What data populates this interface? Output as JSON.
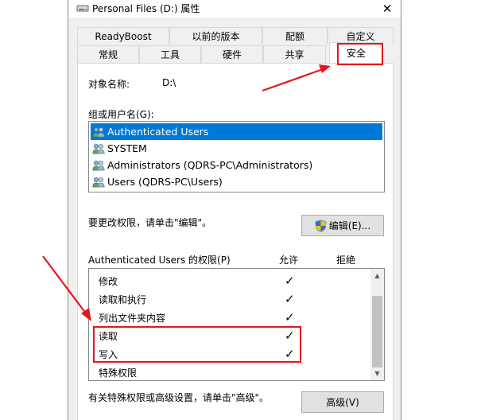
{
  "window": {
    "title": "Personal Files (D:) 属性",
    "close_glyph": "✕"
  },
  "tabs": {
    "row1": [
      "ReadyBoost",
      "以前的版本",
      "配额",
      "自定义"
    ],
    "row2": [
      "常规",
      "工具",
      "硬件",
      "共享",
      "安全"
    ],
    "active": "安全"
  },
  "security": {
    "object_label": "对象名称:",
    "object_value": "D:\\",
    "group_label": "组或用户名(G):",
    "users": [
      "Authenticated Users",
      "SYSTEM",
      "Administrators (QDRS-PC\\Administrators)",
      "Users (QDRS-PC\\Users)"
    ],
    "change_hint": "要更改权限，请单击\"编辑\"。",
    "edit_button": "编辑(E)...",
    "perm_label": "Authenticated Users 的权限(P)",
    "allow_header": "允许",
    "deny_header": "拒绝",
    "permissions": [
      {
        "name": "修改",
        "allow": "✓"
      },
      {
        "name": "读取和执行",
        "allow": "✓"
      },
      {
        "name": "列出文件夹内容",
        "allow": "✓"
      },
      {
        "name": "读取",
        "allow": "✓"
      },
      {
        "name": "写入",
        "allow": "✓"
      },
      {
        "name": "特殊权限",
        "allow": ""
      }
    ],
    "advanced_hint": "有关特殊权限或高级设置，请单击\"高级\"。",
    "advanced_button": "高级(V)"
  },
  "colors": {
    "selection": "#0078d7",
    "annotation": "#e8141c"
  }
}
